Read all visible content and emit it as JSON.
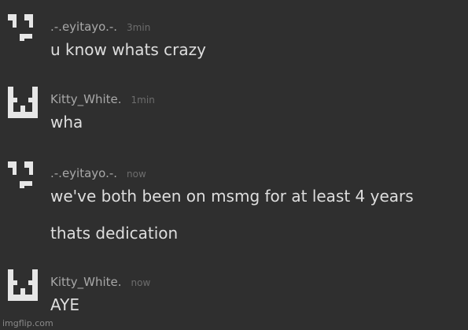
{
  "colors": {
    "background": "#2f2f2f",
    "username": "#a8a8a8",
    "timestamp": "#6d6d6d",
    "message_text": "#dedede",
    "avatar": "#e6e6e6"
  },
  "messages": [
    {
      "avatar_icon": "pixel-face-avatar-icon",
      "username": ".-.eyitayo.-.",
      "time": "3min",
      "lines": [
        "u know whats crazy"
      ]
    },
    {
      "avatar_icon": "pixel-cat-avatar-icon",
      "username": "Kitty_White.",
      "time": "1min",
      "lines": [
        "wha"
      ]
    },
    {
      "avatar_icon": "pixel-face-avatar-icon",
      "username": ".-.eyitayo.-.",
      "time": "now",
      "lines": [
        "we've both been on msmg for at least 4 years",
        "thats dedication"
      ]
    },
    {
      "avatar_icon": "pixel-cat-avatar-icon",
      "username": "Kitty_White.",
      "time": "now",
      "lines": [
        "AYE"
      ]
    }
  ],
  "watermark": "imgflip.com"
}
